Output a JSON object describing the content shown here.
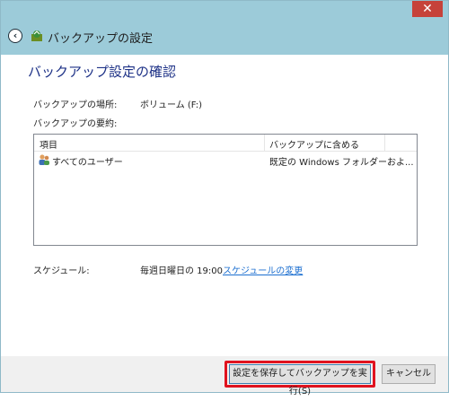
{
  "window": {
    "close_glyph": "✕"
  },
  "header": {
    "title": "バックアップの設定",
    "back_icon": "back-arrow-icon",
    "app_icon": "backup-icon"
  },
  "main": {
    "page_title": "バックアップ設定の確認",
    "location_label": "バックアップの場所:",
    "location_value": "ボリューム (F:)",
    "summary_label": "バックアップの要約:",
    "table": {
      "columns": [
        "項目",
        "バックアップに含める"
      ],
      "rows": [
        {
          "icon": "users-icon",
          "item": "すべてのユーザー",
          "detail": "既定の Windows フォルダーおよ..."
        }
      ]
    },
    "schedule_label": "スケジュール:",
    "schedule_value": "毎週日曜日の 19:00",
    "schedule_link": "スケジュールの変更"
  },
  "footer": {
    "save_run_label": "設定を保存してバックアップを実行(S)",
    "cancel_label": "キャンセル"
  },
  "colors": {
    "accent": "#9ccbd9",
    "title_blue": "#1e3287",
    "link": "#1c6fd0",
    "highlight": "#e0131f"
  }
}
